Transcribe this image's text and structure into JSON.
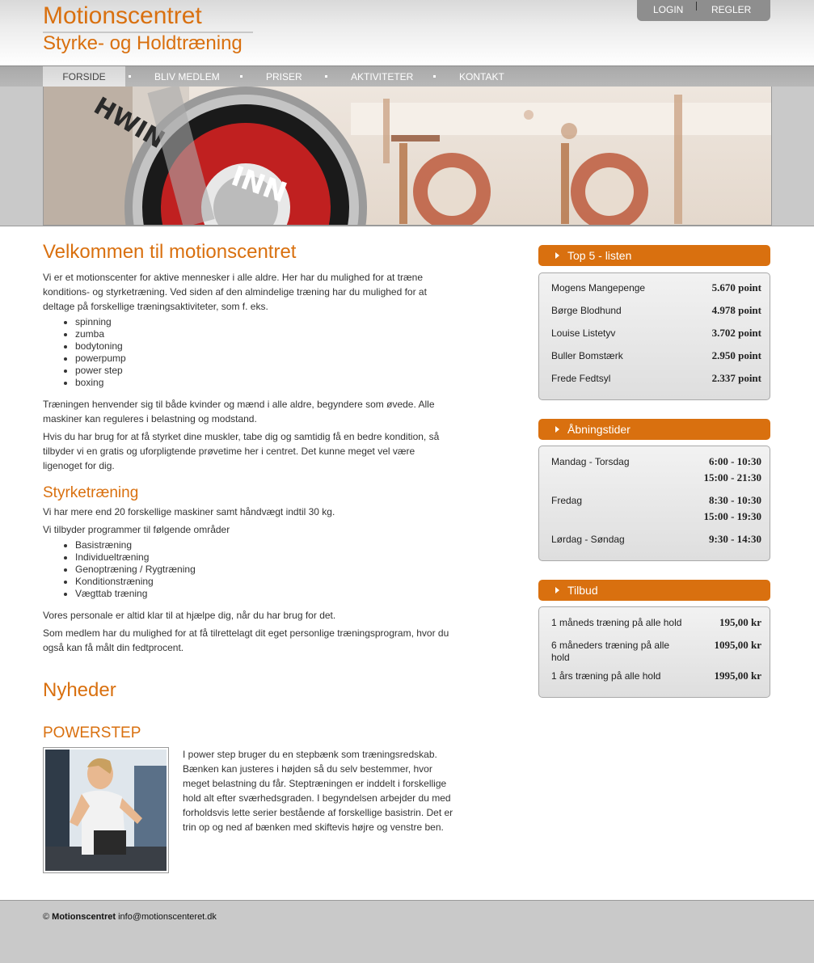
{
  "header": {
    "site_title": "Motionscentret",
    "subtitle": "Styrke- og Holdtræning",
    "login_label": "LOGIN",
    "rules_label": "REGLER"
  },
  "nav": {
    "items": [
      "FORSIDE",
      "BLIV MEDLEM",
      "PRISER",
      "AKTIVITETER",
      "KONTAKT"
    ],
    "active": "FORSIDE"
  },
  "main": {
    "welcome_heading": "Velkommen til motionscentret",
    "intro": "Vi er et motionscenter for aktive mennesker i alle aldre. Her har du mulighed for at træne konditions- og styrketræning. Ved siden af den almindelige træning har du mulighed for at deltage på forskellige træningsaktiviteter, som f. eks.",
    "activities": [
      "spinning",
      "zumba",
      "bodytoning",
      "powerpump",
      "power step",
      "boxing"
    ],
    "para2": "Træningen henvender sig til både kvinder og mænd i alle aldre, begyndere som øvede. Alle maskiner kan reguleres i belastning og modstand.",
    "para3": "Hvis du har brug for at få styrket dine muskler, tabe dig og samtidig få en bedre kondition, så tilbyder vi en gratis og uforpligtende prøvetime her i centret. Det kunne meget vel være ligenoget for dig.",
    "strength_heading": "Styrketræning",
    "strength_p1": "Vi har mere end 20 forskellige maskiner samt håndvægt indtil 30 kg.",
    "strength_p2": "Vi tilbyder programmer til følgende områder",
    "programs": [
      "Basistræning",
      "Individueltræning",
      "Genoptræning / Rygtræning",
      "Konditionstræning",
      "Vægttab træning"
    ],
    "strength_p3": "Vores personale er altid klar til at hjælpe dig, når du har brug for det.",
    "strength_p4": "Som medlem har du mulighed for at få tilrettelagt dit eget personlige træningsprogram, hvor du også kan få målt din fedtprocent.",
    "news_heading": "Nyheder",
    "news_title": "POWERSTEP",
    "news_text": "I power step bruger du en stepbænk som træningsredskab. Bænken kan justeres i højden så du selv bestemmer, hvor meget belastning du får. Steptræningen er inddelt i forskellige hold alt efter sværhedsgraden. I begyndelsen arbejder du med forholdsvis lette serier bestående af forskellige basistrin. Det er trin op og ned af bænken med skiftevis højre og venstre ben."
  },
  "sidebar": {
    "top5": {
      "title": "Top 5 - listen",
      "rows": [
        {
          "name": "Mogens Mangepenge",
          "value": "5.670 point"
        },
        {
          "name": "Børge Blodhund",
          "value": "4.978 point"
        },
        {
          "name": "Louise Listetyv",
          "value": "3.702 point"
        },
        {
          "name": "Buller Bomstærk",
          "value": "2.950 point"
        },
        {
          "name": "Frede Fedtsyl",
          "value": "2.337 point"
        }
      ]
    },
    "hours": {
      "title": "Åbningstider",
      "rows": [
        {
          "day": "Mandag - Torsdag",
          "t1": "6:00 - 10:30",
          "t2": "15:00 - 21:30"
        },
        {
          "day": "Fredag",
          "t1": "8:30 - 10:30",
          "t2": "15:00 - 19:30"
        },
        {
          "day": "Lørdag - Søndag",
          "t1": "9:30 - 14:30",
          "t2": ""
        }
      ]
    },
    "offers": {
      "title": "Tilbud",
      "rows": [
        {
          "name": "1 måneds træning på alle hold",
          "value": "195,00 kr"
        },
        {
          "name": "6 måneders træning på alle hold",
          "value": "1095,00 kr"
        },
        {
          "name": "1 års træning på alle hold",
          "value": "1995,00 kr"
        }
      ]
    }
  },
  "footer": {
    "copyright": "©",
    "brand": "Motionscentret",
    "email": "info@motionscenteret.dk"
  },
  "colors": {
    "accent": "#d9700f",
    "nav_gray": "#b0b0b0",
    "footer_gray": "#c9c9c9"
  }
}
